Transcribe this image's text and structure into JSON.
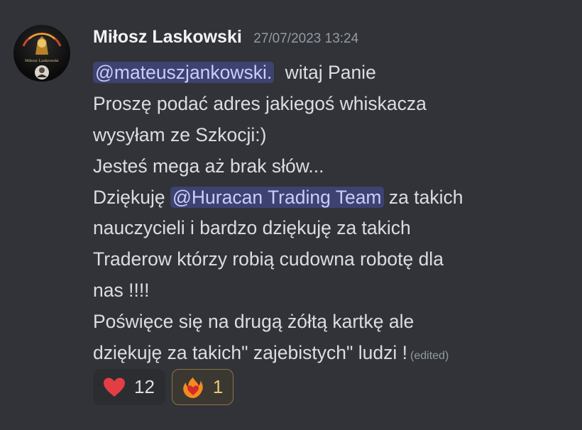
{
  "message": {
    "author": "Miłosz Laskowski",
    "avatar_label": "Miłosz Laskowski",
    "timestamp": "27/07/2023 13:24",
    "lines": [
      {
        "mention": "@mateuszjankowski.",
        "text": " witaj Panie"
      },
      {
        "text": "Proszę podać adres jakiegoś whiskacza"
      },
      {
        "text": "wysyłam ze Szkocji:)"
      },
      {
        "text": "Jesteś mega aż brak słów..."
      },
      {
        "before": "Dziękuję ",
        "mention": "@Huracan Trading Team",
        "after": " za takich"
      },
      {
        "text": "nauczycieli i bardzo dziękuję za takich"
      },
      {
        "text": "Traderow którzy robią cudowna robotę dla"
      },
      {
        "text": "nas !!!!"
      },
      {
        "text": "Poświęce się na drugą żółtą kartkę ale"
      },
      {
        "text": "dziękuję za takich\" zajebistych\" ludzi !",
        "edited": "(edited)"
      }
    ]
  },
  "reactions": [
    {
      "icon": "heart-emoji",
      "count": "12",
      "active": false,
      "color": "#e33e44"
    },
    {
      "icon": "fire-heart-emoji",
      "count": "1",
      "active": true,
      "color": "#f58b1f"
    }
  ],
  "colors": {
    "background": "#313338",
    "mention_bg": "#3e4270",
    "mention_text": "#c9cdfb",
    "text": "#dbdee1",
    "muted": "#949ba4"
  }
}
